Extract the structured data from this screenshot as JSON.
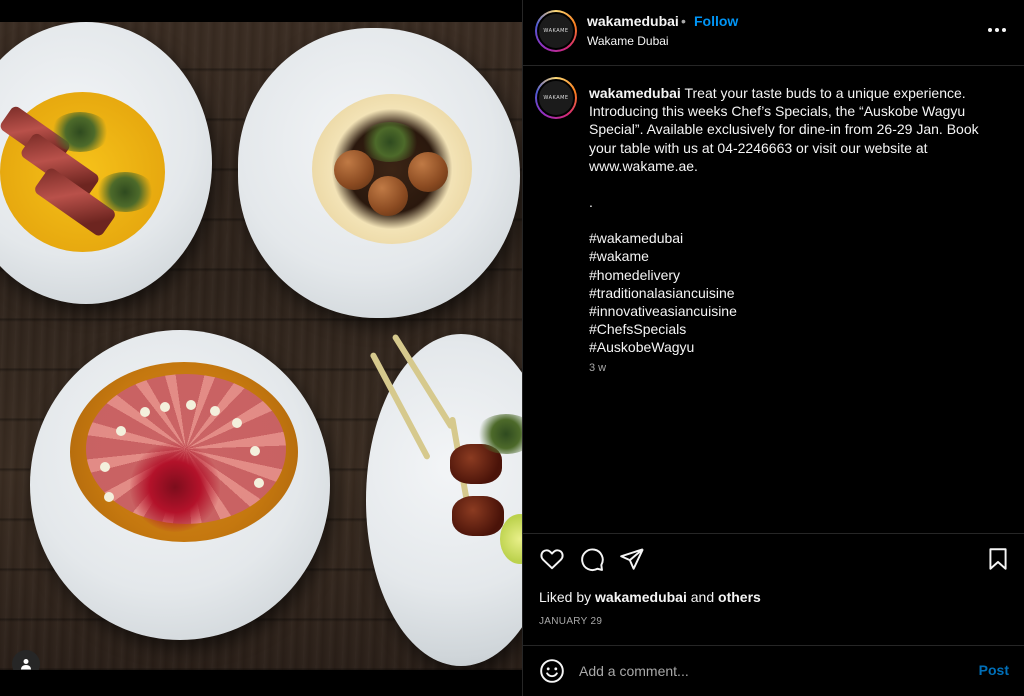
{
  "post": {
    "image_alt": "Four plates of food on a wooden table",
    "user_tag_icon": "person-icon"
  },
  "header": {
    "avatar_text": "WAKAME",
    "username": "wakamedubai",
    "separator": "•",
    "follow_label": "Follow",
    "location": "Wakame Dubai",
    "more_icon": "more-horizontal-icon"
  },
  "caption": {
    "avatar_text": "WAKAME",
    "username": "wakamedubai",
    "lines": [
      "Treat your taste buds to a unique experience.",
      "Introducing this weeks Chef’s Specials, the “Auskobe Wagyu",
      "Special”. Available exclusively for dine-in from 26-29 Jan. Book",
      "your table with us at 04-2246663 or visit our website at",
      "www.wakame.ae.",
      "",
      ".",
      "",
      "#wakamedubai",
      "#wakame",
      "#homedelivery",
      "#traditionalasiancuisine",
      "#innovativeasiancuisine",
      "#ChefsSpecials",
      "#AuskobeWagyu"
    ],
    "time_ago": "3 w"
  },
  "actions": {
    "like_icon": "heart-icon",
    "comment_icon": "comment-icon",
    "share_icon": "share-icon",
    "save_icon": "bookmark-icon"
  },
  "likes": {
    "prefix": "Liked by",
    "user": "wakamedubai",
    "conjunction": "and",
    "others": "others"
  },
  "date": "JANUARY 29",
  "comment": {
    "emoji_icon": "emoji-icon",
    "placeholder": "Add a comment...",
    "post_label": "Post"
  },
  "colors": {
    "accent": "#0095f6",
    "background": "#000000",
    "text": "#f5f5f5",
    "muted": "#a8a8a8",
    "divider": "#262626"
  }
}
